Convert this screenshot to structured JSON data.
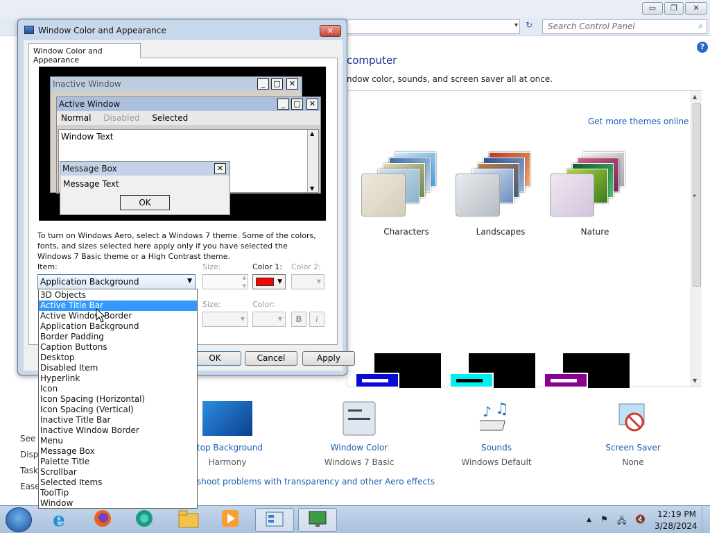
{
  "control_panel": {
    "title_buttons": {
      "minimize": "▭",
      "maximize": "❐",
      "close": "✕"
    },
    "address_dropdown": "▾",
    "refresh": "↻",
    "search_placeholder": "Search Control Panel",
    "help": "?",
    "heading": "computer",
    "subheading": "ndow color, sounds, and screen saver all at once.",
    "get_more_themes": "Get more themes online",
    "themes": [
      {
        "label": "Characters"
      },
      {
        "label": "Landscapes"
      },
      {
        "label": "Nature"
      }
    ],
    "bottom_items": [
      {
        "link": "ktop Background",
        "sub": "Harmony"
      },
      {
        "link": "Window Color",
        "sub": "Windows 7 Basic"
      },
      {
        "link": "Sounds",
        "sub": "Windows Default"
      },
      {
        "link": "Screen Saver",
        "sub": "None"
      }
    ],
    "troubleshoot": "shoot problems with transparency and other Aero effects",
    "see_also": [
      "See a",
      "Displ",
      "Task",
      "Ease"
    ],
    "colors": {
      "link": "#1a5fb4",
      "hc_blue": "#0a0ad6",
      "hc_cyan": "#00f0f0",
      "hc_purple": "#8b0090"
    }
  },
  "dialog": {
    "title": "Window Color and Appearance",
    "close": "✕",
    "tab": "Window Color and Appearance",
    "preview": {
      "inactive_title": "Inactive Window",
      "active_title": "Active Window",
      "menu_normal": "Normal",
      "menu_disabled": "Disabled",
      "menu_selected": "Selected",
      "window_text": "Window Text",
      "message_title": "Message Box",
      "message_text": "Message Text",
      "ok": "OK",
      "btn_min": "_",
      "btn_max": "□",
      "btn_close": "✕"
    },
    "hint": "To turn on Windows Aero, select a Windows 7 theme.  Some of the colors, fonts, and sizes selected here apply only if you have selected the Windows 7 Basic theme or a High Contrast theme.",
    "item_label": "Item:",
    "item_value": "Application Background",
    "size_label": "Size:",
    "color1_label": "Color 1:",
    "color2_label": "Color 2:",
    "color1_value": "#ff0000",
    "font_size_label": "Size:",
    "font_color_label": "Color:",
    "bold": "B",
    "italic": "I",
    "ok": "OK",
    "cancel": "Cancel",
    "apply": "Apply"
  },
  "dropdown": {
    "items": [
      "3D Objects",
      "Active Title Bar",
      "Active Window Border",
      "Application Background",
      "Border Padding",
      "Caption Buttons",
      "Desktop",
      "Disabled Item",
      "Hyperlink",
      "Icon",
      "Icon Spacing (Horizontal)",
      "Icon Spacing (Vertical)",
      "Inactive Title Bar",
      "Inactive Window Border",
      "Menu",
      "Message Box",
      "Palette Title",
      "Scrollbar",
      "Selected Items",
      "ToolTip",
      "Window"
    ],
    "highlighted": "Active Title Bar"
  },
  "taskbar": {
    "apps": [
      {
        "icon": "internet-explorer-icon"
      },
      {
        "icon": "firefox-icon"
      },
      {
        "icon": "edge-icon"
      },
      {
        "icon": "file-explorer-icon"
      },
      {
        "icon": "media-player-icon"
      },
      {
        "icon": "control-panel-icon"
      },
      {
        "icon": "display-settings-icon"
      }
    ],
    "tray": {
      "up": "▲",
      "flag": "⚑",
      "network": "🖧",
      "volume": "🔇"
    },
    "time": "12:19 PM",
    "date": "3/28/2024"
  }
}
